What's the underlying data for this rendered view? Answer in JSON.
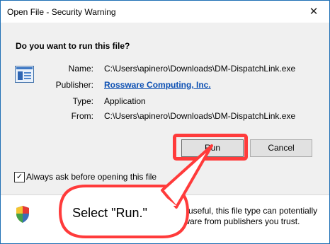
{
  "window": {
    "title": "Open File - Security Warning",
    "close_glyph": "✕"
  },
  "prompt": {
    "question": "Do you want to run this file?"
  },
  "file": {
    "icon": "application-window-icon",
    "name_label": "Name:",
    "name_value": "C:\\Users\\apinero\\Downloads\\DM-DispatchLink.exe",
    "publisher_label": "Publisher:",
    "publisher_value": "Rossware Computing, Inc.",
    "type_label": "Type:",
    "type_value": "Application",
    "from_label": "From:",
    "from_value": "C:\\Users\\apinero\\Downloads\\DM-DispatchLink.exe"
  },
  "buttons": {
    "run": "Run",
    "cancel": "Cancel"
  },
  "checkbox": {
    "label": "Always ask before opening this file",
    "checked": true,
    "check_glyph": "✓"
  },
  "warning": {
    "icon": "shield-icon",
    "line1": "e useful, this file type can potentially",
    "line2": "tware from publishers you trust."
  },
  "annotation": {
    "text": "Select \"Run.\"",
    "highlight_color": "#ff3b3b"
  }
}
